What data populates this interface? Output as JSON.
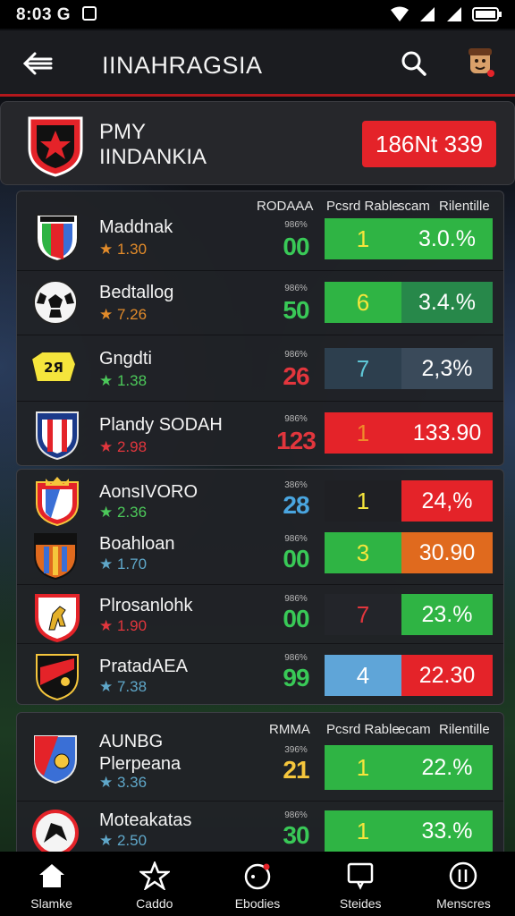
{
  "status": {
    "time": "8:03 G"
  },
  "appbar": {
    "title": "IINAHRAGSIA"
  },
  "my_team": {
    "line1": "PMY",
    "line2": "IINDANKIA",
    "stat": "186Nt 339"
  },
  "colors": {
    "green": "#2fb444",
    "red": "#e42329",
    "orange": "#e06a1e",
    "dark": "#23252a",
    "navy": "#2f4150",
    "blue": "#5fa5d8"
  },
  "groups": [
    {
      "headers": [
        "RODAAA",
        "Pcsrd Rable",
        "scam",
        "Rilentille"
      ],
      "teams": [
        {
          "name": "Maddnak",
          "rating": "★ 1.30",
          "rating_color": "orange",
          "stat_label": "986%",
          "stat": "00",
          "stat_color": "#39c957",
          "pos": "1",
          "pos_color": "#f5e53c",
          "pos_bg": "#2fb444",
          "pct": "3.0.%",
          "pct_bg": "#2fb444",
          "crest": "shield-tricolor"
        },
        {
          "name": "Bedtallog",
          "rating": "★ 7.26",
          "rating_color": "orange",
          "stat_label": "986%",
          "stat": "50",
          "stat_color": "#39c957",
          "pos": "6",
          "pos_color": "#f5e53c",
          "pos_bg": "#2fb444",
          "pct": "3.4.%",
          "pct_bg": "#27884a",
          "crest": "football"
        },
        {
          "name": "Gngdti",
          "rating": "★ 1.38",
          "rating_color": "green",
          "stat_label": "986%",
          "stat": "26",
          "stat_color": "#e2363d",
          "pos": "7",
          "pos_color": "#5fc7d6",
          "pos_bg": "#2d3f4e",
          "pct": "2,3%",
          "pct_bg": "#3a4a5a",
          "crest": "yellow-badge"
        },
        {
          "name": "Plandy SODAH",
          "rating": "★ 2.98",
          "rating_color": "red",
          "stat_label": "986%",
          "stat": "123",
          "stat_color": "#e2363d",
          "pos": "1",
          "pos_color": "#f08a2a",
          "pos_bg": "#e42329",
          "pct": "133.90",
          "pct_bg": "#e42329",
          "crest": "shield-red-white"
        }
      ]
    },
    {
      "headers": [],
      "teams": [
        {
          "name": "AonsIVORO",
          "rating": "★ 2.36",
          "rating_color": "green",
          "stat_label": "386%",
          "stat": "28",
          "stat_color": "#4aa6e0",
          "pos": "1",
          "pos_color": "#f5e53c",
          "pos_bg": "#1f2024",
          "pct": "24,%",
          "pct_bg": "#e42329",
          "crest": "shield-crown"
        },
        {
          "name": "Boahloan",
          "rating": "★ 1.70",
          "rating_color": "teal",
          "stat_label": "986%",
          "stat": "00",
          "stat_color": "#39c957",
          "pos": "3",
          "pos_color": "#f5e53c",
          "pos_bg": "#2fb444",
          "pct": "30.90",
          "pct_bg": "#e06a1e",
          "crest": "shield-orange"
        },
        {
          "name": "Plrosanlohk",
          "rating": "★ 1.90",
          "rating_color": "red",
          "stat_label": "986%",
          "stat": "00",
          "stat_color": "#39c957",
          "pos": "7",
          "pos_color": "#e2363d",
          "pos_bg": "#23252a",
          "pct": "23.%",
          "pct_bg": "#2fb444",
          "crest": "shield-horse"
        },
        {
          "name": "PratadAEA",
          "rating": "★ 7.38",
          "rating_color": "teal",
          "stat_label": "986%",
          "stat": "99",
          "stat_color": "#39c957",
          "pos": "4",
          "pos_color": "#ffffff",
          "pos_bg": "#5fa5d8",
          "pct": "22.30",
          "pct_bg": "#e42329",
          "crest": "shield-black-red"
        }
      ]
    },
    {
      "headers": [
        "RMMA",
        "Pcsrd Rable",
        "ecam",
        "Rilentille"
      ],
      "teams": [
        {
          "name": "AUNBG\nPlerpeana",
          "rating": "★ 3.36",
          "rating_color": "teal",
          "stat_label": "396%",
          "stat": "21",
          "stat_color": "#f5c63c",
          "pos": "1",
          "pos_color": "#f5e53c",
          "pos_bg": "#2fb444",
          "pct": "22.%",
          "pct_bg": "#2fb444",
          "crest": "shield-blue-red"
        },
        {
          "name": "Moteakatas",
          "rating": "★ 2.50",
          "rating_color": "teal",
          "stat_label": "986%",
          "stat": "30",
          "stat_color": "#39c957",
          "pos": "1",
          "pos_color": "#f5e53c",
          "pos_bg": "#2fb444",
          "pct": "33.%",
          "pct_bg": "#2fb444",
          "crest": "round-badge"
        }
      ]
    }
  ],
  "bottom_nav": [
    {
      "label": "Slamke",
      "icon": "home-icon"
    },
    {
      "label": "Caddo",
      "icon": "star-outline-icon"
    },
    {
      "label": "Ebodies",
      "icon": "circle-dot-icon"
    },
    {
      "label": "Steides",
      "icon": "message-icon"
    },
    {
      "label": "Menscres",
      "icon": "info-circle-icon"
    }
  ]
}
